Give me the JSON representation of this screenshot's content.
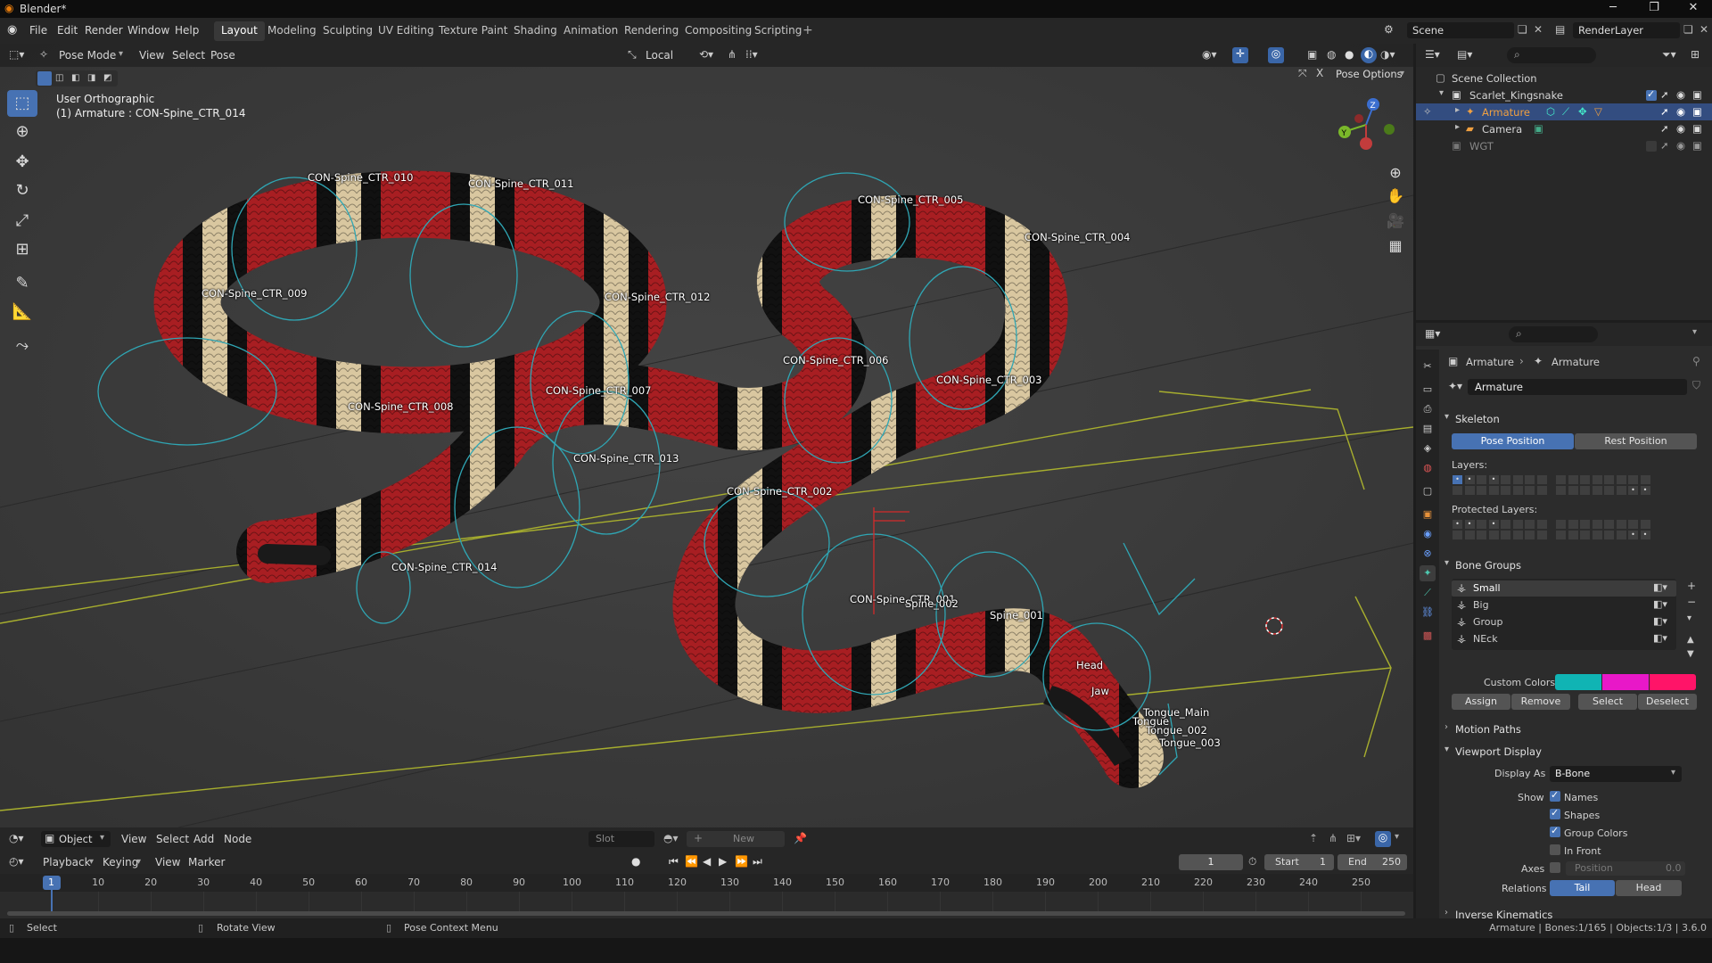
{
  "window": {
    "title": "Blender*"
  },
  "menubar": {
    "items": [
      "File",
      "Edit",
      "Render",
      "Window",
      "Help"
    ]
  },
  "workspaces": [
    "Layout",
    "Modeling",
    "Sculpting",
    "UV Editing",
    "Texture Paint",
    "Shading",
    "Animation",
    "Rendering",
    "Compositing",
    "Scripting"
  ],
  "active_workspace": "Layout",
  "scene": {
    "name": "Scene",
    "view_layer": "RenderLayer"
  },
  "viewport": {
    "mode": "Pose Mode",
    "menus": [
      "View",
      "Select",
      "Pose"
    ],
    "orientation": "Local",
    "pose_options": "Pose Options",
    "view_name": "User Orthographic",
    "active_info": "(1) Armature : CON-Spine_CTR_014",
    "bone_labels": [
      "CON-Spine_CTR_010",
      "CON-Spine_CTR_011",
      "CON-Spine_CTR_005",
      "CON-Spine_CTR_004",
      "CON-Spine_CTR_009",
      "CON-Spine_CTR_012",
      "CON-Spine_CTR_006",
      "CON-Spine_CTR_007",
      "CON-Spine_CTR_003",
      "CON-Spine_CTR_008",
      "CON-Spine_CTR_013",
      "CON-Spine_CTR_002",
      "CON-Spine_CTR_014",
      "CON-Spine_CTR_001",
      "Spine_002",
      "Spine_001",
      "Head",
      "Jaw",
      "Tongue_Main",
      "Tongue",
      "Tongue_002",
      "Tongue_003"
    ],
    "axes": {
      "x": "X",
      "y": "Y",
      "z": "Z"
    }
  },
  "node_header": {
    "mode": "Object",
    "menus": [
      "View",
      "Select",
      "Add",
      "Node"
    ],
    "slot": "Slot",
    "new_label": "New"
  },
  "timeline": {
    "menus": [
      "Playback",
      "Keying",
      "View",
      "Marker"
    ],
    "current_frame": "1",
    "start_label": "Start",
    "start": "1",
    "end_label": "End",
    "end": "250",
    "ticks": [
      "1",
      "10",
      "20",
      "30",
      "40",
      "50",
      "60",
      "70",
      "80",
      "90",
      "100",
      "110",
      "120",
      "130",
      "140",
      "150",
      "160",
      "170",
      "180",
      "190",
      "200",
      "210",
      "220",
      "230",
      "240",
      "250"
    ]
  },
  "statusbar": {
    "select": "Select",
    "rotate": "Rotate View",
    "context": "Pose Context Menu",
    "stats": "Armature | Bones:1/165 | Objects:1/3 | 3.6.0"
  },
  "outliner": {
    "rows": [
      {
        "label": "Scene Collection"
      },
      {
        "label": "Scarlet_Kingsnake"
      },
      {
        "label": "Armature"
      },
      {
        "label": "Camera"
      },
      {
        "label": "WGT"
      }
    ]
  },
  "properties": {
    "breadcrumb": [
      "Armature",
      "Armature"
    ],
    "datablock": "Armature",
    "skeleton": {
      "title": "Skeleton",
      "pose_position": "Pose Position",
      "rest_position": "Rest Position",
      "layers_label": "Layers:",
      "protected_label": "Protected Layers:"
    },
    "bone_groups": {
      "title": "Bone Groups",
      "items": [
        "Small",
        "Big",
        "Group",
        "NEck"
      ],
      "custom_colors_label": "Custom Colors",
      "colors": [
        "#10b4b4",
        "#e818c8",
        "#ff1468"
      ],
      "buttons": [
        "Assign",
        "Remove",
        "Select",
        "Deselect"
      ]
    },
    "motion_paths": "Motion Paths",
    "viewport_display": {
      "title": "Viewport Display",
      "display_as_label": "Display As",
      "display_as": "B-Bone",
      "show_label": "Show",
      "names": "Names",
      "shapes": "Shapes",
      "group_colors": "Group Colors",
      "in_front": "In Front",
      "axes_label": "Axes",
      "position_label": "Position",
      "position_value": "0.0",
      "relations_label": "Relations",
      "tail": "Tail",
      "head": "Head"
    },
    "inverse_kinematics": "Inverse Kinematics"
  }
}
